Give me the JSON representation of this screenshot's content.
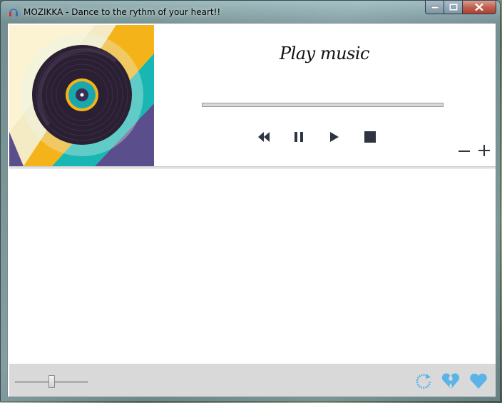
{
  "window": {
    "title": "MOZIKKA - Dance to the rythm of your heart!!"
  },
  "header": {
    "play_title": "Play music",
    "progress_fraction": 0.0
  },
  "controls": {
    "rewind_icon": "rewind-icon",
    "pause_icon": "pause-icon",
    "play_icon": "play-icon",
    "stop_icon": "stop-icon",
    "volume_down_icon": "minus-icon",
    "volume_up_icon": "plus-icon"
  },
  "playlist": {
    "items": []
  },
  "footer": {
    "volume_level": 0.5,
    "refresh_icon": "refresh-icon",
    "unfavorite_icon": "broken-heart-icon",
    "favorite_icon": "heart-icon"
  },
  "colors": {
    "accent_blue": "#5ab4e8",
    "control_dark": "#2e3440",
    "album_yellow": "#f5b31a",
    "album_teal": "#19b7b3",
    "album_purple": "#5b4e8c",
    "album_cream": "#fbf3d2"
  }
}
